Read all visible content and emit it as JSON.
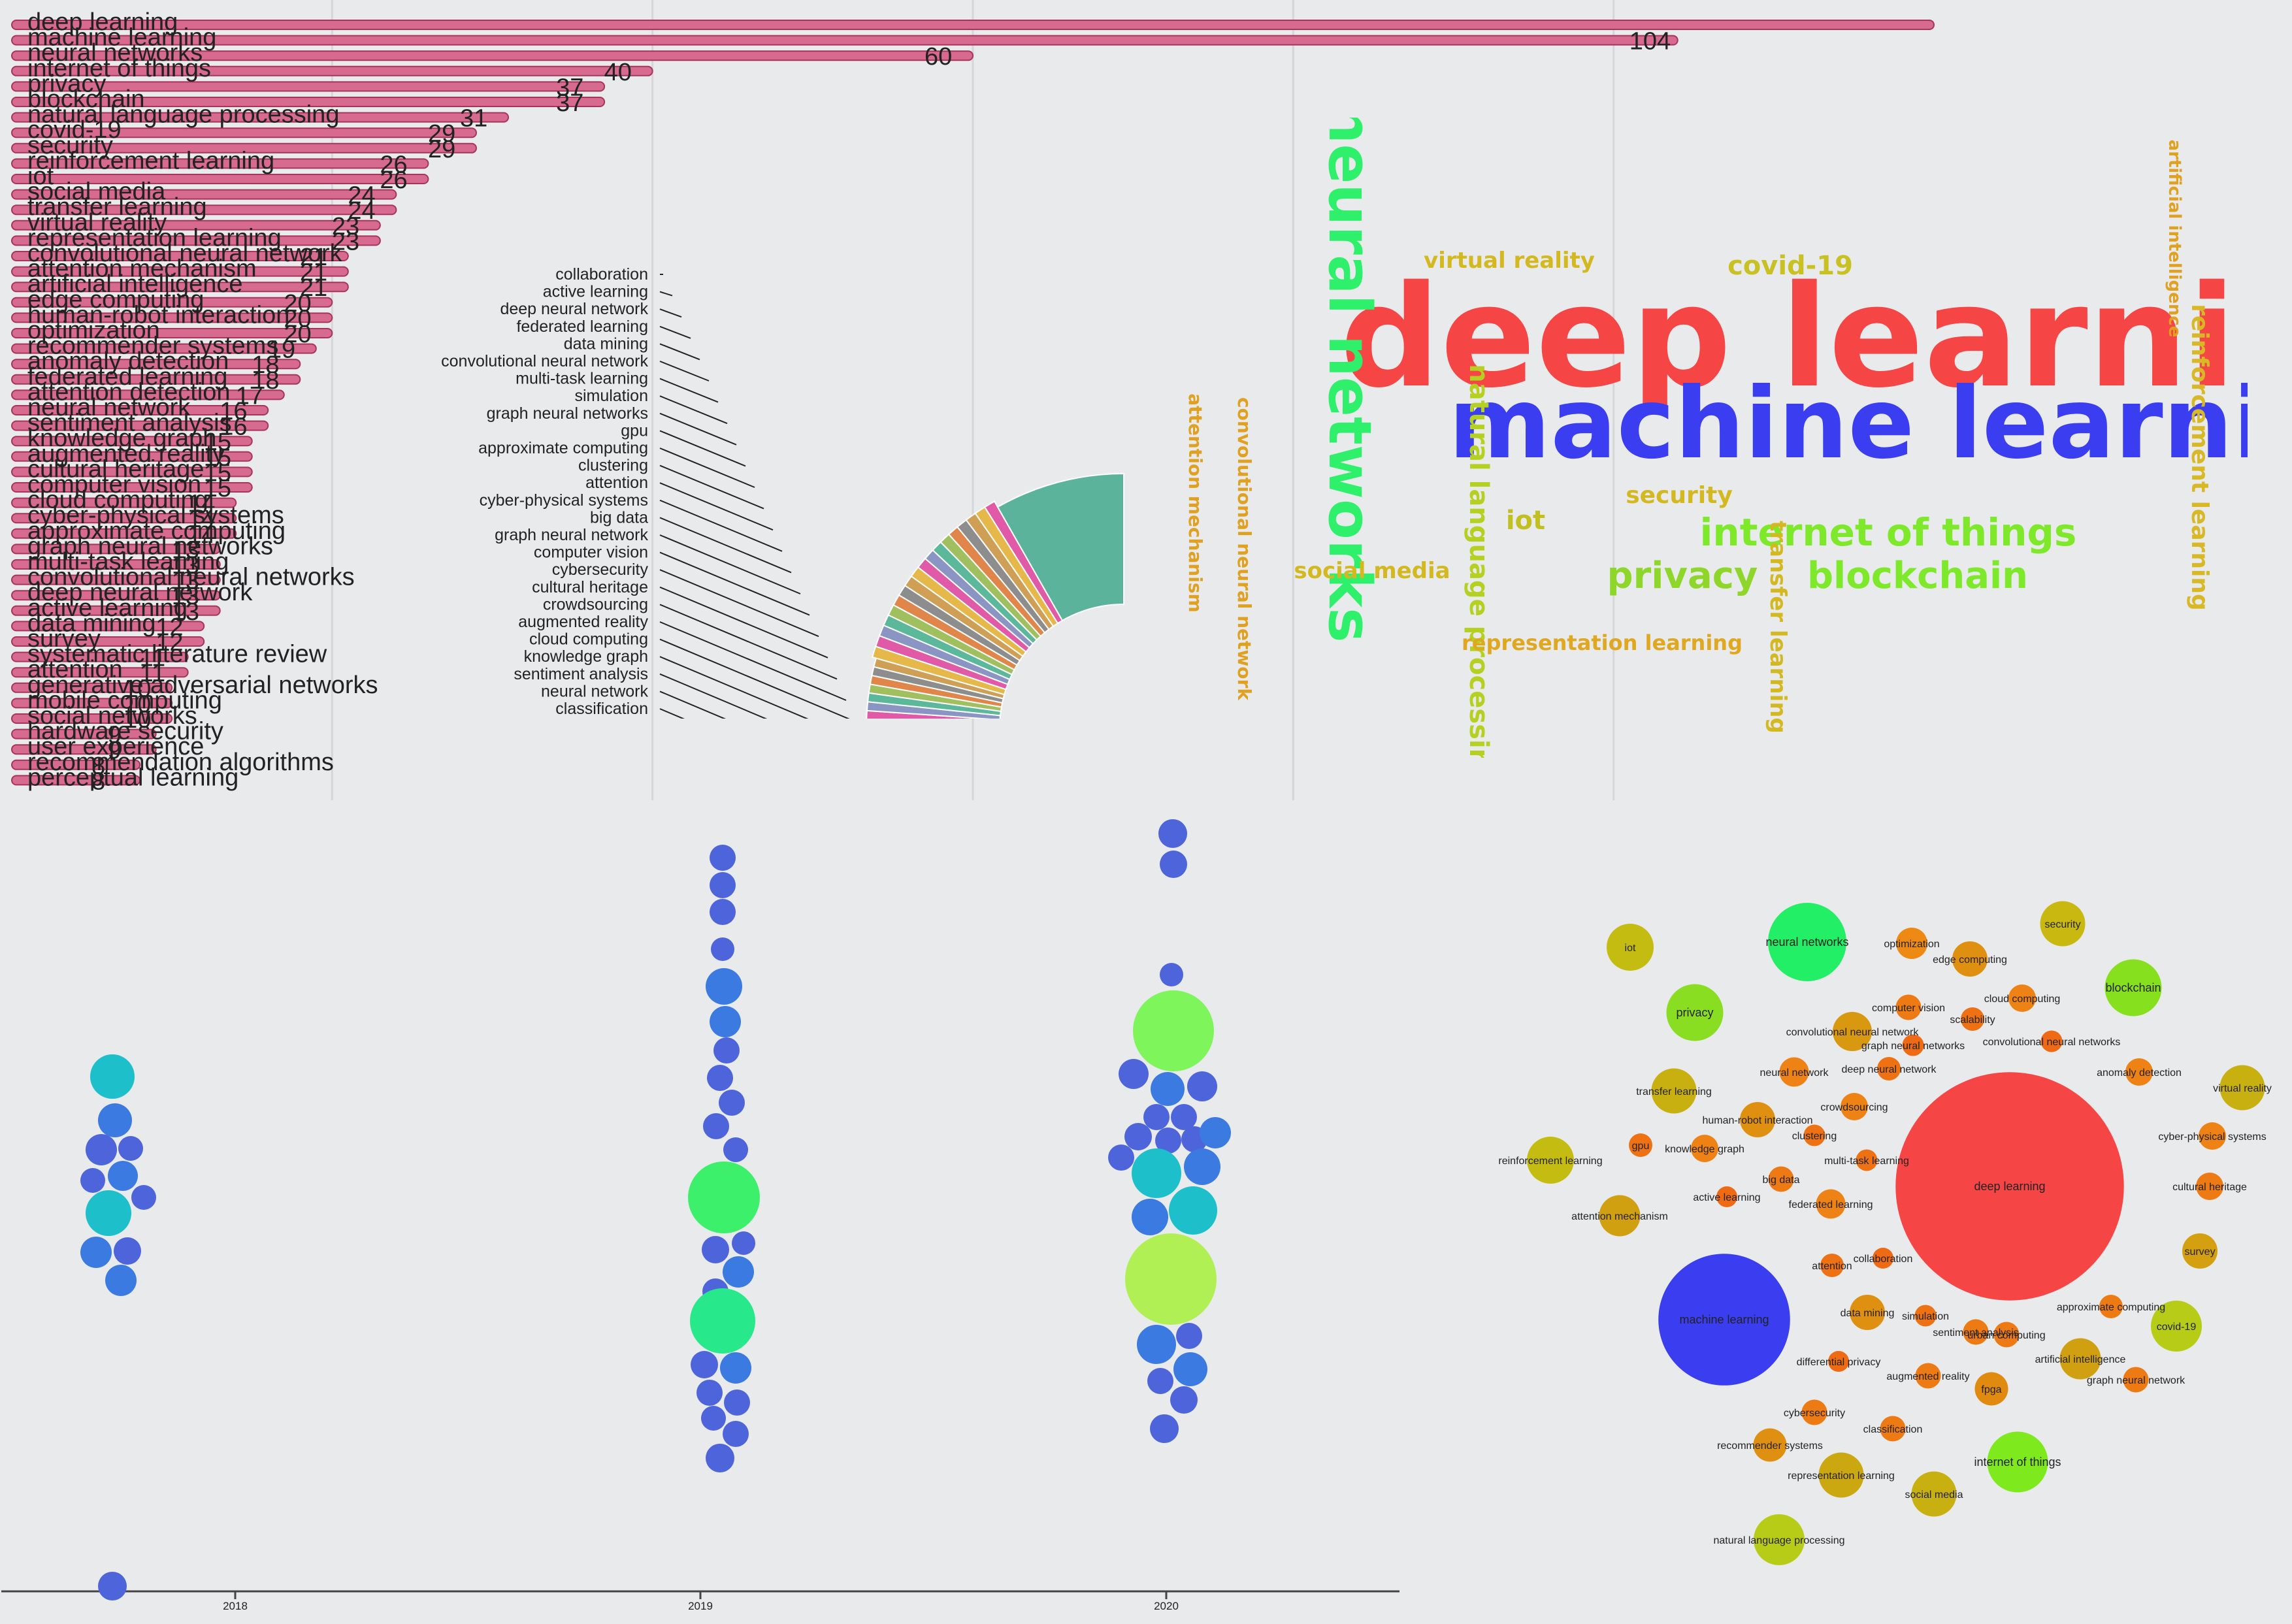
{
  "chart_data": [
    {
      "type": "bar",
      "orientation": "horizontal",
      "xlim": [
        0,
        120
      ],
      "x_grid": [
        20,
        40,
        60,
        80,
        100
      ],
      "categories": [
        "deep learning",
        "machine learning",
        "neural networks",
        "internet of things",
        "privacy",
        "blockchain",
        "natural language processing",
        "covid-19",
        "security",
        "reinforcement learning",
        "iot",
        "social media",
        "transfer learning",
        "virtual reality",
        "representation learning",
        "convolutional neural network",
        "attention mechanism",
        "artificial intelligence",
        "edge computing",
        "human-robot interaction",
        "optimization",
        "recommender systems",
        "anomaly detection",
        "federated learning",
        "attention detection",
        "neural network",
        "sentiment analysis",
        "knowledge graph",
        "augmented reality",
        "cultural heritage",
        "computer vision",
        "cloud computing",
        "cyber-physical systems",
        "approximate computing",
        "graph neural networks",
        "multi-task learning",
        "convolutional neural networks",
        "deep neural network",
        "active learning",
        "data mining",
        "survey",
        "systematic literature review",
        "attention",
        "generative adversarial networks",
        "mobile computing",
        "social networks",
        "hardware security",
        "user experience",
        "recommendation algorithms",
        "perceptual learning"
      ],
      "values": [
        120,
        104,
        60,
        40,
        37,
        37,
        31,
        29,
        29,
        26,
        26,
        24,
        24,
        23,
        23,
        21,
        21,
        21,
        20,
        20,
        20,
        19,
        18,
        18,
        17,
        16,
        16,
        15,
        15,
        15,
        15,
        14,
        14,
        14,
        13,
        13,
        13,
        13,
        13,
        12,
        12,
        11,
        11,
        10,
        10,
        10,
        9,
        9,
        8,
        8
      ],
      "labels": [
        "",
        "104",
        "60",
        "40",
        "37",
        "37",
        "31",
        "29",
        "29",
        "26",
        "26",
        "24",
        "24",
        "23",
        "23",
        "21",
        "21",
        "21",
        "20",
        "20",
        "20",
        "19",
        "18",
        "18",
        "17",
        "16",
        "16",
        "15",
        "15",
        "15",
        "15",
        "14",
        "14",
        "14",
        "13",
        "13",
        "13",
        "13",
        "13",
        "12",
        "12",
        "11",
        "11",
        "10",
        "10",
        "10",
        "9",
        "9",
        "8",
        "8"
      ],
      "bar_color": "#d66a8f",
      "bar_stroke": "#a8345c"
    },
    {
      "type": "bar",
      "subtype": "radial",
      "categories": [
        "collaboration",
        "active learning",
        "deep neural network",
        "federated learning",
        "data mining",
        "convolutional neural network",
        "multi-task learning",
        "simulation",
        "graph neural networks",
        "gpu",
        "approximate computing",
        "clustering",
        "attention",
        "cyber-physical systems",
        "big data",
        "graph neural network",
        "computer vision",
        "cybersecurity",
        "cultural heritage",
        "crowdsourcing",
        "augmented reality",
        "cloud computing",
        "knowledge graph",
        "sentiment analysis",
        "neural network",
        "classification"
      ],
      "values": [
        4,
        4,
        4,
        4,
        4,
        4,
        4,
        4,
        5,
        5,
        5,
        5,
        5,
        5,
        5,
        5,
        5,
        5,
        5,
        5,
        5,
        5,
        5,
        5,
        5,
        5
      ],
      "highlight_value": 60,
      "colors": [
        "#e6b84a",
        "#e05aa7",
        "#8a95c4",
        "#5cb89a",
        "#a0c060",
        "#e0864a",
        "#8d8d8d",
        "#cf9f56",
        "#e6b84a",
        "#e05aa7",
        "#8a95c4",
        "#5cb89a",
        "#a0c060",
        "#e0864a",
        "#8d8d8d",
        "#cf9f56",
        "#e6b84a",
        "#e05aa7",
        "#8a95c4",
        "#5cb89a",
        "#a0c060",
        "#e0864a",
        "#8d8d8d",
        "#cf9f56",
        "#e6b84a",
        "#e05aa7"
      ],
      "highlight_color": "#5cb39b"
    },
    {
      "type": "wordcloud",
      "words": [
        {
          "text": "deep learning",
          "weight": 104,
          "color": "#f64545"
        },
        {
          "text": "machine learning",
          "weight": 60,
          "color": "#3a3ef0"
        },
        {
          "text": "neural networks",
          "weight": 40,
          "color": "#2ef06a"
        },
        {
          "text": "internet of things",
          "weight": 31,
          "color": "#7ee82a"
        },
        {
          "text": "blockchain",
          "weight": 29,
          "color": "#7ee82a"
        },
        {
          "text": "privacy",
          "weight": 29,
          "color": "#8fd62a"
        },
        {
          "text": "natural language processing",
          "weight": 26,
          "color": "#b5d021"
        },
        {
          "text": "reinforcement learning",
          "weight": 24,
          "color": "#d8b825"
        },
        {
          "text": "covid-19",
          "weight": 26,
          "color": "#c9c021"
        },
        {
          "text": "iot",
          "weight": 24,
          "color": "#c2c020"
        },
        {
          "text": "security",
          "weight": 24,
          "color": "#d4b820"
        },
        {
          "text": "transfer learning",
          "weight": 23,
          "color": "#d4b820"
        },
        {
          "text": "virtual reality",
          "weight": 23,
          "color": "#d4b820"
        },
        {
          "text": "social media",
          "weight": 24,
          "color": "#d4b820"
        },
        {
          "text": "representation learning",
          "weight": 23,
          "color": "#e0a820"
        },
        {
          "text": "convolutional neural network",
          "weight": 21,
          "color": "#e0a020"
        },
        {
          "text": "attention mechanism",
          "weight": 21,
          "color": "#e0a020"
        },
        {
          "text": "artificial intelligence",
          "weight": 21,
          "color": "#e0a020"
        }
      ]
    },
    {
      "type": "scatter",
      "subtype": "beeswarm",
      "x_ticks": [
        "2018",
        "2019",
        "2020"
      ]
    },
    {
      "type": "scatter",
      "subtype": "bubble",
      "bubbles": [
        {
          "label": "deep learning",
          "value": 104,
          "color": "#f64545"
        },
        {
          "label": "machine learning",
          "value": 60,
          "color": "#3a3ef0"
        },
        {
          "label": "neural networks",
          "value": 40,
          "color": "#22ee66"
        },
        {
          "label": "internet of things",
          "value": 31,
          "color": "#7eea1e"
        },
        {
          "label": "blockchain",
          "value": 29,
          "color": "#86e01e"
        },
        {
          "label": "privacy",
          "value": 29,
          "color": "#8ade22"
        },
        {
          "label": "natural language processing",
          "value": 26,
          "color": "#b6cc16"
        },
        {
          "label": "covid-19",
          "value": 26,
          "color": "#b6cc16"
        },
        {
          "label": "reinforcement learning",
          "value": 24,
          "color": "#c4bc10"
        },
        {
          "label": "iot",
          "value": 24,
          "color": "#c4bc10"
        },
        {
          "label": "security",
          "value": 23,
          "color": "#c8b810"
        },
        {
          "label": "social media",
          "value": 23,
          "color": "#c8b010"
        },
        {
          "label": "transfer learning",
          "value": 23,
          "color": "#c8b010"
        },
        {
          "label": "virtual reality",
          "value": 23,
          "color": "#c8b010"
        },
        {
          "label": "representation learning",
          "value": 23,
          "color": "#cca810"
        },
        {
          "label": "attention mechanism",
          "value": 21,
          "color": "#d0a010"
        },
        {
          "label": "artificial intelligence",
          "value": 21,
          "color": "#d0a010"
        },
        {
          "label": "survey",
          "value": 18,
          "color": "#d4a010"
        },
        {
          "label": "convolutional neural network",
          "value": 20,
          "color": "#d89810"
        },
        {
          "label": "edge computing",
          "value": 18,
          "color": "#e09010"
        },
        {
          "label": "human-robot interaction",
          "value": 18,
          "color": "#e09010"
        },
        {
          "label": "data mining",
          "value": 18,
          "color": "#e09010"
        },
        {
          "label": "recommender systems",
          "value": 17,
          "color": "#e09010"
        },
        {
          "label": "fpga",
          "value": 17,
          "color": "#e08a10"
        },
        {
          "label": "optimization",
          "value": 16,
          "color": "#ee8a14"
        },
        {
          "label": "neural network",
          "value": 15,
          "color": "#ee8214"
        },
        {
          "label": "federated learning",
          "value": 15,
          "color": "#ee8214"
        },
        {
          "label": "cloud computing",
          "value": 14,
          "color": "#ee8214"
        },
        {
          "label": "knowledge graph",
          "value": 14,
          "color": "#ee8214"
        },
        {
          "label": "crowdsourcing",
          "value": 14,
          "color": "#ee8214"
        },
        {
          "label": "anomaly detection",
          "value": 14,
          "color": "#ee8214"
        },
        {
          "label": "cyber-physical systems",
          "value": 14,
          "color": "#ee8214"
        },
        {
          "label": "cultural heritage",
          "value": 14,
          "color": "#ee7a14"
        },
        {
          "label": "approximate computing",
          "value": 12,
          "color": "#ee7a14"
        },
        {
          "label": "graph neural network",
          "value": 13,
          "color": "#ee7a14"
        },
        {
          "label": "augmented reality",
          "value": 13,
          "color": "#ee7a14"
        },
        {
          "label": "sentiment analysis",
          "value": 13,
          "color": "#ee7a14"
        },
        {
          "label": "urban computing",
          "value": 13,
          "color": "#ee7a14"
        },
        {
          "label": "cybersecurity",
          "value": 13,
          "color": "#ee7a14"
        },
        {
          "label": "classification",
          "value": 13,
          "color": "#ee7a14"
        },
        {
          "label": "big data",
          "value": 13,
          "color": "#ee7a14"
        },
        {
          "label": "computer vision",
          "value": 13,
          "color": "#ee7a14"
        },
        {
          "label": "deep neural network",
          "value": 12,
          "color": "#ee7214"
        },
        {
          "label": "attention",
          "value": 12,
          "color": "#ee7214"
        },
        {
          "label": "gpu",
          "value": 12,
          "color": "#ee7214"
        },
        {
          "label": "scalability",
          "value": 12,
          "color": "#ee7214"
        },
        {
          "label": "clustering",
          "value": 11,
          "color": "#ee7214"
        },
        {
          "label": "multi-task learning",
          "value": 11,
          "color": "#ee7214"
        },
        {
          "label": "simulation",
          "value": 11,
          "color": "#ee7214"
        },
        {
          "label": "graph neural networks",
          "value": 11,
          "color": "#ee6a14"
        },
        {
          "label": "convolutional neural networks",
          "value": 11,
          "color": "#ee6a14"
        },
        {
          "label": "collaboration",
          "value": 10,
          "color": "#ee6a14"
        },
        {
          "label": "differential privacy",
          "value": 10,
          "color": "#ee6a14"
        },
        {
          "label": "active learning",
          "value": 10,
          "color": "#ee6a14"
        }
      ]
    }
  ]
}
